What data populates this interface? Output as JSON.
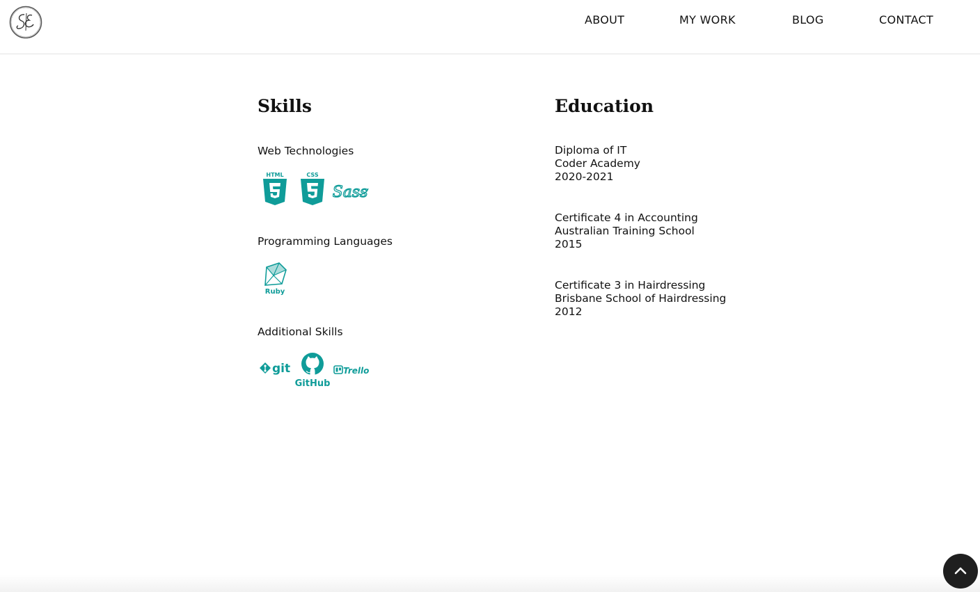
{
  "header": {
    "logo_icon": "signature-logo-icon",
    "nav": [
      {
        "label": "ABOUT"
      },
      {
        "label": "MY WORK"
      },
      {
        "label": "BLOG"
      },
      {
        "label": "CONTACT"
      }
    ]
  },
  "skills": {
    "title": "Skills",
    "groups": [
      {
        "heading": "Web Technologies",
        "icons": [
          "html5-icon",
          "css3-icon",
          "sass-icon"
        ]
      },
      {
        "heading": "Programming Languages",
        "icons": [
          "ruby-icon"
        ]
      },
      {
        "heading": "Additional Skills",
        "icons": [
          "git-icon",
          "github-icon",
          "trello-icon"
        ]
      }
    ],
    "icon_labels": {
      "html": "HTML",
      "css": "CSS",
      "sass": "Sass",
      "ruby": "Ruby",
      "git": "git",
      "github": "GitHub",
      "trello": "Trello"
    }
  },
  "education": {
    "title": "Education",
    "items": [
      {
        "course": "Diploma of IT",
        "school": "Coder Academy",
        "years": "2020-2021"
      },
      {
        "course": "Certificate 4 in Accounting",
        "school": "Australian Training School",
        "years": "2015"
      },
      {
        "course": "Certificate 3 in Hairdressing",
        "school": "Brisbane School of Hairdressing",
        "years": "2012"
      }
    ]
  },
  "back_to_top_icon": "chevron-up-icon",
  "colors": {
    "accent": "#0f9c99",
    "text": "#111111",
    "button_bg": "#1f1f1f"
  }
}
